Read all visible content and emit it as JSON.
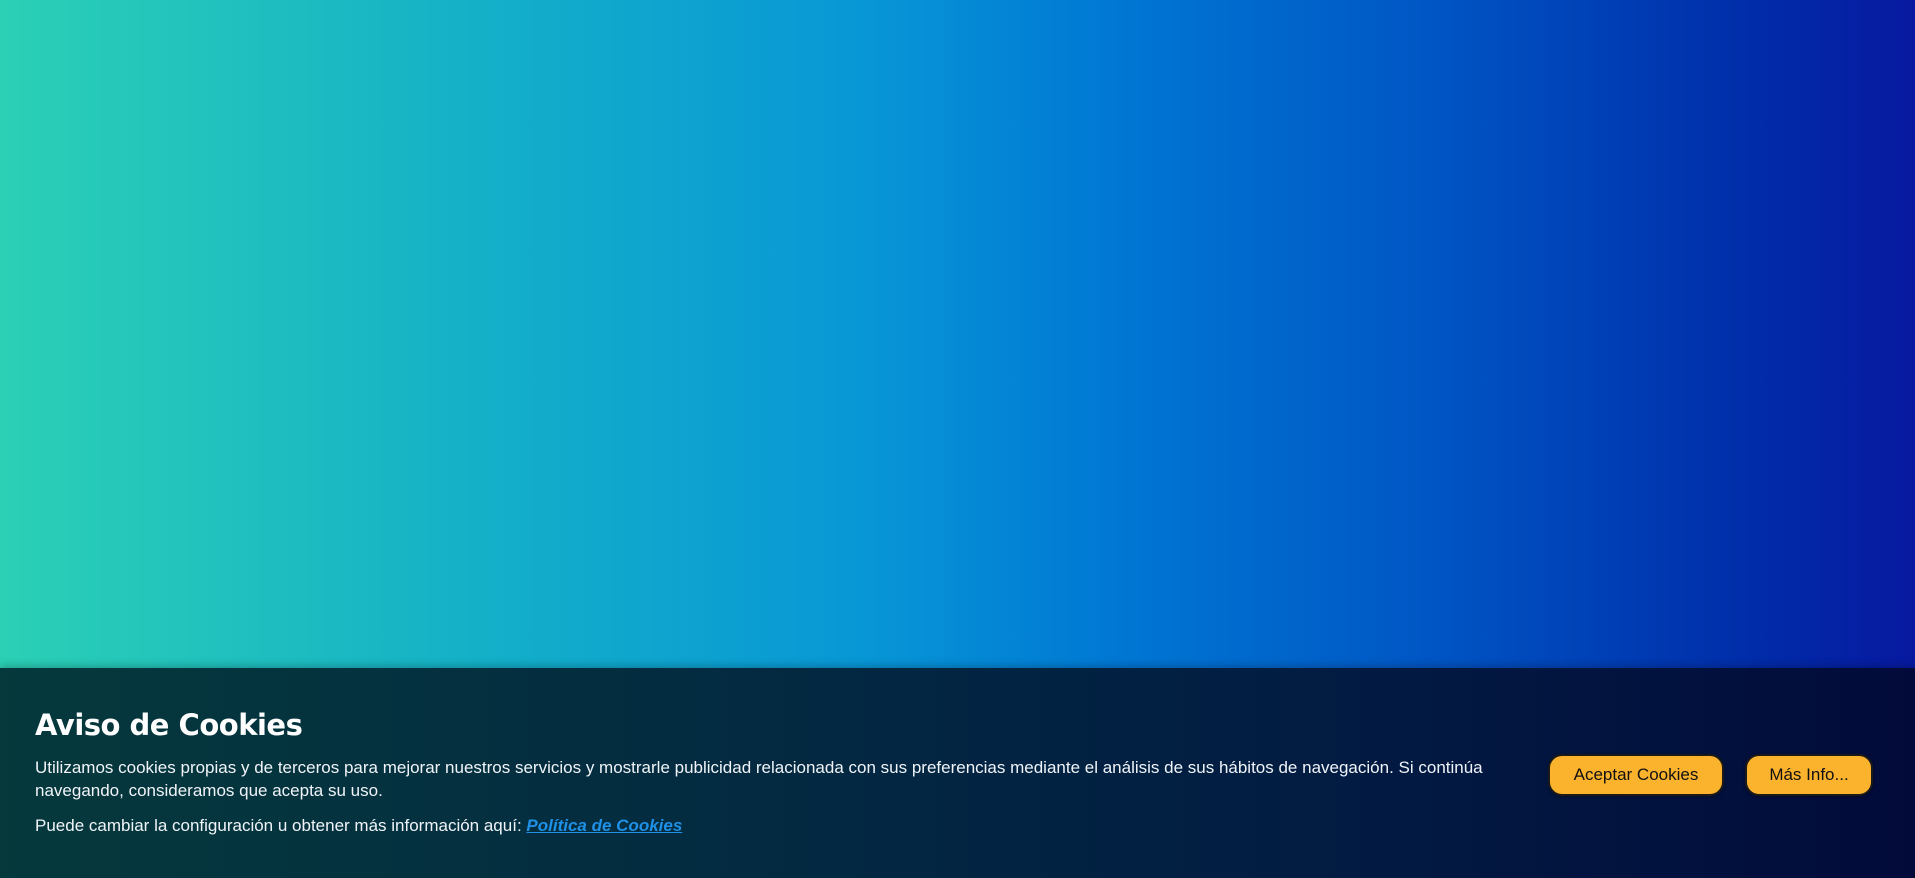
{
  "cookie_banner": {
    "title": "Aviso de Cookies",
    "description": "Utilizamos cookies propias y de terceros para mejorar nuestros servicios y mostrarle publicidad relacionada con sus preferencias mediante el análisis de sus hábitos de navegación. Si continúa navegando, consideramos que acepta su uso.",
    "config_text": "Puede cambiar la configuración u obtener más información aquí:",
    "policy_link": "Política de Cookies",
    "accept_label": "Aceptar Cookies",
    "more_info_label": "Más Info..."
  },
  "colors": {
    "gradient_start": "#2bd0b5",
    "gradient_end": "#0719a0",
    "button": "#fbb22d",
    "link": "#1e90e6"
  }
}
